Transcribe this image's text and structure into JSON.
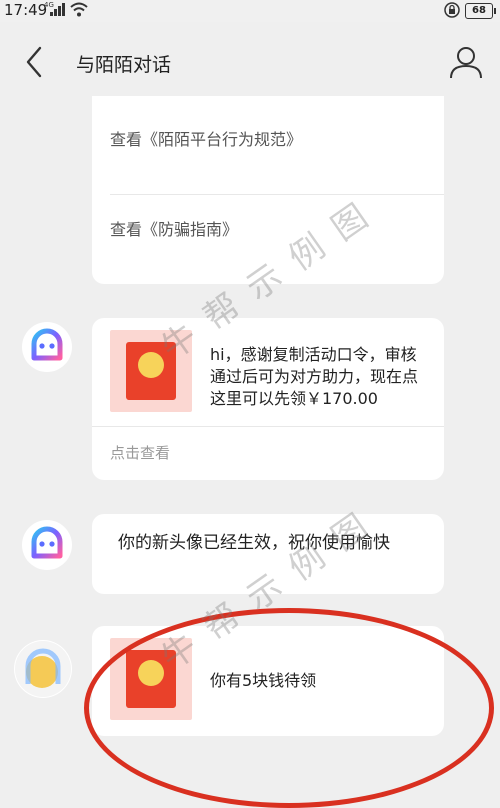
{
  "status_bar": {
    "time": "17:49",
    "network": "4G",
    "battery": "68"
  },
  "header": {
    "title": "与陌陌对话"
  },
  "messages": {
    "system_card": {
      "link_rules": "查看《陌陌平台行为规范》",
      "link_fraud": "查看《防骗指南》"
    },
    "red_packet_msg": {
      "text": "hi，感谢复制活动口令，审核通过后可为对方助力，现在点这里可以先领￥170.00",
      "action": "点击查看"
    },
    "avatar_msg": {
      "text": "你的新头像已经生效，祝你使用愉快"
    },
    "last_msg": {
      "text": "你有5块钱待领"
    }
  },
  "watermark": {
    "text": "牛帮示例图"
  },
  "colors": {
    "annotation": "#d93020",
    "envelope_red": "#e9412a",
    "envelope_bg": "#fbd7d2",
    "coin": "#f7d35a"
  }
}
